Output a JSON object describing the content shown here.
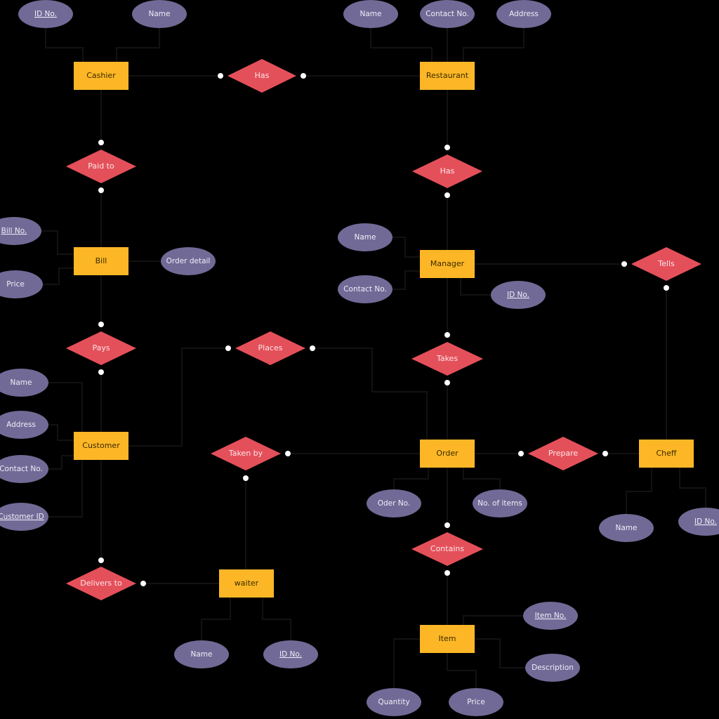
{
  "colors": {
    "background": "#000000",
    "entity": "#FDB726",
    "relationship": "#E4505A",
    "attribute": "#716A96",
    "connector_dot": "#FFFFFF"
  },
  "entities": {
    "cashier": "Cashier",
    "restaurant": "Restaurant",
    "bill": "Bill",
    "manager": "Manager",
    "customer": "Customer",
    "order": "Order",
    "cheff": "Cheff",
    "waiter": "waiter",
    "item": "Item"
  },
  "relationships": {
    "has_cashier_restaurant": "Has",
    "has_restaurant_manager": "Has",
    "paid_to": "Paid to",
    "tells": "Tells",
    "pays": "Pays",
    "places": "Places",
    "takes": "Takes",
    "taken_by": "Taken by",
    "prepare": "Prepare",
    "delivers_to": "Delivers to",
    "contains": "Contains"
  },
  "attributes": {
    "cashier": {
      "id": "ID No.",
      "name": "Name"
    },
    "restaurant": {
      "name": "Name",
      "contact": "Contact No.",
      "address": "Address"
    },
    "bill": {
      "bill_no": "Bill No.",
      "price": "Price",
      "order_detail": "Order detail"
    },
    "manager": {
      "name": "Name",
      "contact": "Contact No.",
      "id": "ID No."
    },
    "customer": {
      "name": "Name",
      "address": "Address",
      "contact": "Contact No.",
      "customer_id": "Customer ID"
    },
    "order": {
      "order_no": "Oder No.",
      "num_items": "No. of items"
    },
    "cheff": {
      "name": "Name",
      "id": "ID No."
    },
    "waiter": {
      "name": "Name",
      "id": "ID No."
    },
    "item": {
      "item_no": "Item No.",
      "description": "Description",
      "quantity": "Quantity",
      "price": "Price"
    }
  }
}
